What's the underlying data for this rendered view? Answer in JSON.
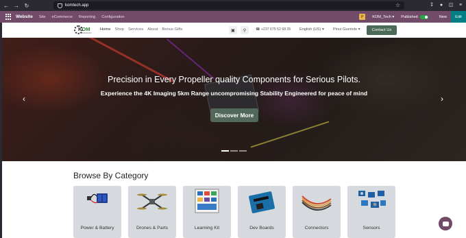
{
  "browser": {
    "url": "komtech.app",
    "back_icon": "arrow-left-icon",
    "forward_icon": "arrow-right-icon",
    "reload_icon": "reload-icon"
  },
  "adminbar": {
    "brand": "Website",
    "menu": [
      "Site",
      "eCommerce",
      "Reporting",
      "Configuration"
    ],
    "badge": "P",
    "website_name": "KOM_Tech ▾",
    "published_label": "Published",
    "new_label": "New",
    "edit_label": "Edit",
    "accent_color": "#714b67"
  },
  "header": {
    "logo_text_left": "K",
    "logo_text_right": "OM",
    "logo_sub": "TECHNOLOGY",
    "nav": [
      "Home",
      "Shop",
      "Services",
      "About",
      "Bonus Gifts"
    ],
    "phone": "+237 675 52 68 35",
    "language": "English (US) ▾",
    "user": "Pinui Gueriole ▾",
    "contact_label": "Contact Us"
  },
  "hero": {
    "headline": "Precision in Every Propeller quality Components for Serious Pilots.",
    "subline": "Experience the 4K Imaging 5km Range uncompromising Stability Engineered for peace of mind",
    "cta_label": "Discover More",
    "prev_icon": "chevron-left-icon",
    "next_icon": "chevron-right-icon",
    "slide_count": 3,
    "active_slide": 1
  },
  "categories": {
    "title": "Browse By Category",
    "items": [
      {
        "label": "Power & Battery"
      },
      {
        "label": "Drones & Parts"
      },
      {
        "label": "Learning Kit"
      },
      {
        "label": "Dev Boards"
      },
      {
        "label": "Connectors"
      },
      {
        "label": "Sensors"
      }
    ]
  }
}
